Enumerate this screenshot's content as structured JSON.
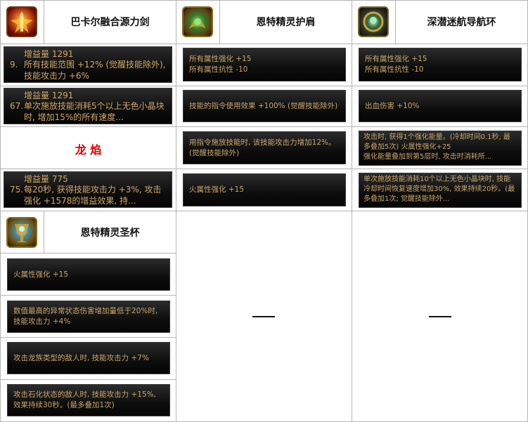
{
  "items": [
    {
      "name": "巴卡尔融合源力剑",
      "icon": "red-gold-sword-item-icon",
      "panels": [
        {
          "head": "增益量 1291",
          "num": "9.",
          "text": "所有技能范围 +12% (觉醒技能除外), 技能攻击力 +6%"
        },
        {
          "head": "增益量 1291",
          "num": "67.",
          "text": "单次施放技能消耗5个以上无色小晶块时, 增加15%的所有速度..."
        },
        {
          "head": "",
          "num": "",
          "text": "龙 焰",
          "style": "red-label"
        },
        {
          "head": "增益量 775",
          "num": "75.",
          "text": "每20秒, 获得技能攻击力 +3%, 攻击强化 +1578的增益效果, 持..."
        }
      ]
    },
    {
      "name": "恩特精灵护肩",
      "icon": "green-gold-shoulder-item-icon",
      "panels": [
        {
          "text": "所有属性强化 +15\n所有属性抗性 -10"
        },
        {
          "text": "技能的指令使用效果 +100% (觉醒技能除外)"
        },
        {
          "text": "用指令施放技能时, 该技能攻击力增加12%。(觉醒技能除外)"
        },
        {
          "text": "火属性强化 +15"
        }
      ]
    },
    {
      "name": "深潜迷航导航环",
      "icon": "compass-ring-item-icon",
      "panels": [
        {
          "text": "所有属性强化 +15\n所有属性抗性 -10"
        },
        {
          "text": "出血伤害 +10%"
        },
        {
          "text": "攻击时, 获得1个强化能量。(冷却时间0.1秒, 最多叠加5次)        火属性强化+25\n强化能量叠加到第5层时, 攻击时消耗所..."
        },
        {
          "text": "单次施放技能消耗10个以上无色小晶块时, 技能冷却时间恢复速度增加30%, 效果持续20秒。(最多叠加1次; 觉醒技能除外..."
        }
      ]
    },
    {
      "name": "恩特精灵圣杯",
      "icon": "green-gold-chalice-item-icon",
      "panels": [
        {
          "text": "火属性强化 +15"
        },
        {
          "text": "数值最高的异常状态伤害增加量低于20%时, 技能攻击力 +4%"
        },
        {
          "text": "攻击龙族类型的敌人时, 技能攻击力 +7%"
        },
        {
          "text": "攻击石化状态的敌人时, 技能攻击力 +15%, 效果持续30秒。(最多叠加1次)"
        }
      ]
    }
  ],
  "empty_cells": [
    "—",
    "—"
  ]
}
